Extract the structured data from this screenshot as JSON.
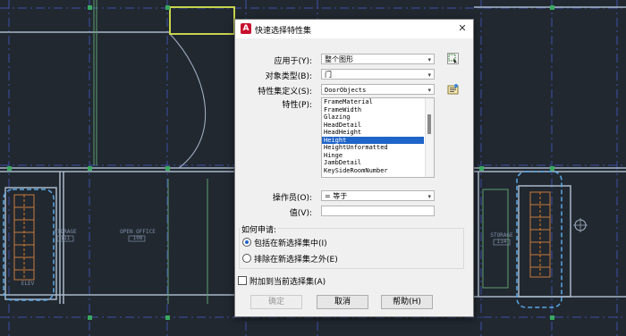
{
  "dialog": {
    "title": "快速选择特性集",
    "app_icon": "autocad-icon",
    "fields": {
      "apply_to": {
        "label": "应用于(Y):",
        "value": "整个图形"
      },
      "object_type": {
        "label": "对象类型(B):",
        "value": "门"
      },
      "property_set_def": {
        "label": "特性集定义(S):",
        "value": "DoorObjects"
      },
      "property": {
        "label": "特性(P):"
      },
      "operator": {
        "label": "操作员(O):",
        "value": "= 等于"
      },
      "value": {
        "label": "值(V):",
        "value": ""
      }
    },
    "property_list": [
      "FrameMaterial",
      "FrameWidth",
      "Glazing",
      "HeadDetail",
      "HeadHeight",
      "Height",
      "HeightUnformatted",
      "Hinge",
      "JambDetail",
      "KeySideRoomNumber"
    ],
    "selected_property": "Height",
    "how_to_apply": {
      "label": "如何申请:",
      "options": [
        {
          "label": "包括在新选择集中(I)",
          "checked": true
        },
        {
          "label": "排除在新选择集之外(E)",
          "checked": false
        }
      ]
    },
    "append_checkbox": {
      "label": "附加到当前选择集(A)",
      "checked": false
    },
    "buttons": {
      "ok": "确定",
      "cancel": "取消",
      "help": "帮助(H)"
    }
  },
  "drawing": {
    "room_labels": [
      {
        "name": "STORAGE",
        "number": "111"
      },
      {
        "name": "OPEN OFFICE",
        "number": "108"
      },
      {
        "name": "STORAGE",
        "number": "114"
      },
      {
        "name": "ELEV",
        "number": ""
      }
    ],
    "colors": {
      "background": "#212830",
      "grid": "#3f4fa8",
      "walls": "#a9b7c9",
      "doors": "#c8d44c",
      "selection": "#5aa8e6",
      "accent": "#e07a1c"
    }
  }
}
